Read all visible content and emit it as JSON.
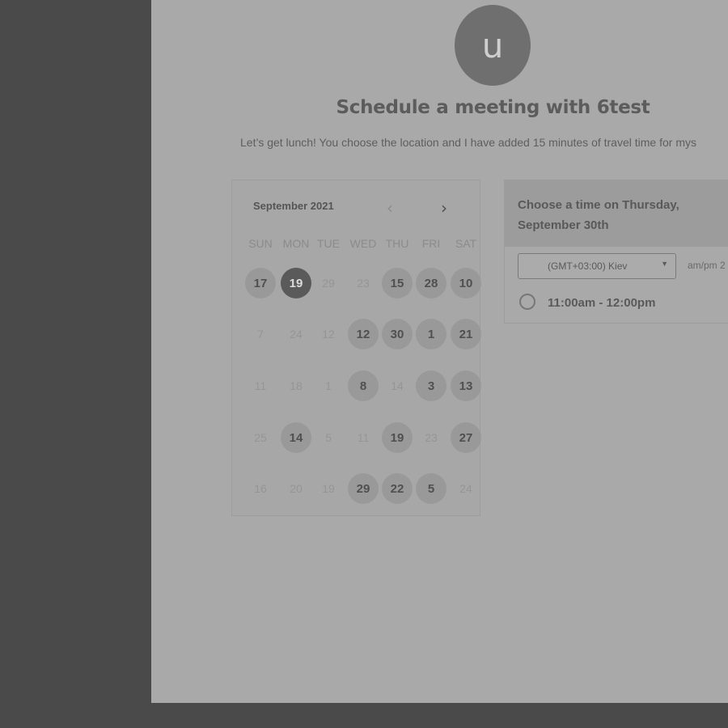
{
  "avatar": {
    "initial": "u"
  },
  "header": {
    "title": "Schedule a meeting with 6test",
    "subtitle": "Let’s get lunch! You choose the location and I have added 15 minutes of travel time for mys"
  },
  "calendar": {
    "month": "September 2021",
    "prev_icon": "chevron-left-icon",
    "next_icon": "chevron-right-icon",
    "weekdays": [
      "SUN",
      "MON",
      "TUE",
      "WED",
      "THU",
      "FRI",
      "SAT"
    ],
    "weeks": [
      [
        {
          "d": "17",
          "s": "on"
        },
        {
          "d": "19",
          "s": "sel"
        },
        {
          "d": "29",
          "s": "off"
        },
        {
          "d": "23",
          "s": "off"
        },
        {
          "d": "15",
          "s": "on"
        },
        {
          "d": "28",
          "s": "on"
        },
        {
          "d": "10",
          "s": "on"
        }
      ],
      [
        {
          "d": "7",
          "s": "off"
        },
        {
          "d": "24",
          "s": "off"
        },
        {
          "d": "12",
          "s": "off"
        },
        {
          "d": "12",
          "s": "on"
        },
        {
          "d": "30",
          "s": "on"
        },
        {
          "d": "1",
          "s": "on"
        },
        {
          "d": "21",
          "s": "on"
        }
      ],
      [
        {
          "d": "11",
          "s": "off"
        },
        {
          "d": "18",
          "s": "off"
        },
        {
          "d": "1",
          "s": "off"
        },
        {
          "d": "8",
          "s": "on"
        },
        {
          "d": "14",
          "s": "off"
        },
        {
          "d": "3",
          "s": "on"
        },
        {
          "d": "13",
          "s": "on"
        }
      ],
      [
        {
          "d": "25",
          "s": "off"
        },
        {
          "d": "14",
          "s": "on"
        },
        {
          "d": "5",
          "s": "off"
        },
        {
          "d": "11",
          "s": "off"
        },
        {
          "d": "19",
          "s": "on"
        },
        {
          "d": "23",
          "s": "off"
        },
        {
          "d": "27",
          "s": "on"
        }
      ],
      [
        {
          "d": "16",
          "s": "off"
        },
        {
          "d": "20",
          "s": "off"
        },
        {
          "d": "19",
          "s": "off"
        },
        {
          "d": "29",
          "s": "on"
        },
        {
          "d": "22",
          "s": "on"
        },
        {
          "d": "5",
          "s": "on"
        },
        {
          "d": "24",
          "s": "off"
        }
      ]
    ]
  },
  "times": {
    "title": "Choose a time on Thursday, September 30th",
    "timezone": "(GMT+03:00) Kiev",
    "caret_icon": "caret-down-icon",
    "format_label": "am/pm 2",
    "slots": [
      "11:00am - 12:00pm"
    ]
  }
}
